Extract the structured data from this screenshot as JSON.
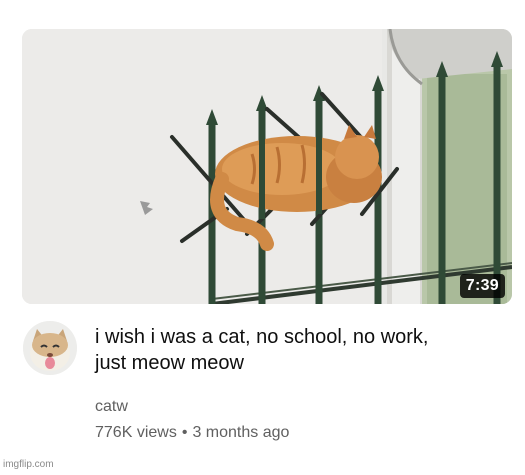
{
  "video": {
    "duration": "7:39",
    "title": "i wish i was a cat, no school, no work,\njust meow meow",
    "channel": "catw",
    "views": "776K views",
    "separator": "•",
    "age": "3 months ago",
    "thumbnail_icon": "cat-on-fence-thumbnail",
    "avatar_icon": "cat-avatar-icon"
  },
  "watermark": {
    "text": "imgflip.com"
  },
  "colors": {
    "title": "#0f0f0f",
    "meta": "#606060",
    "duration_bg": "#000000",
    "cat_orange": "#d38a45"
  }
}
